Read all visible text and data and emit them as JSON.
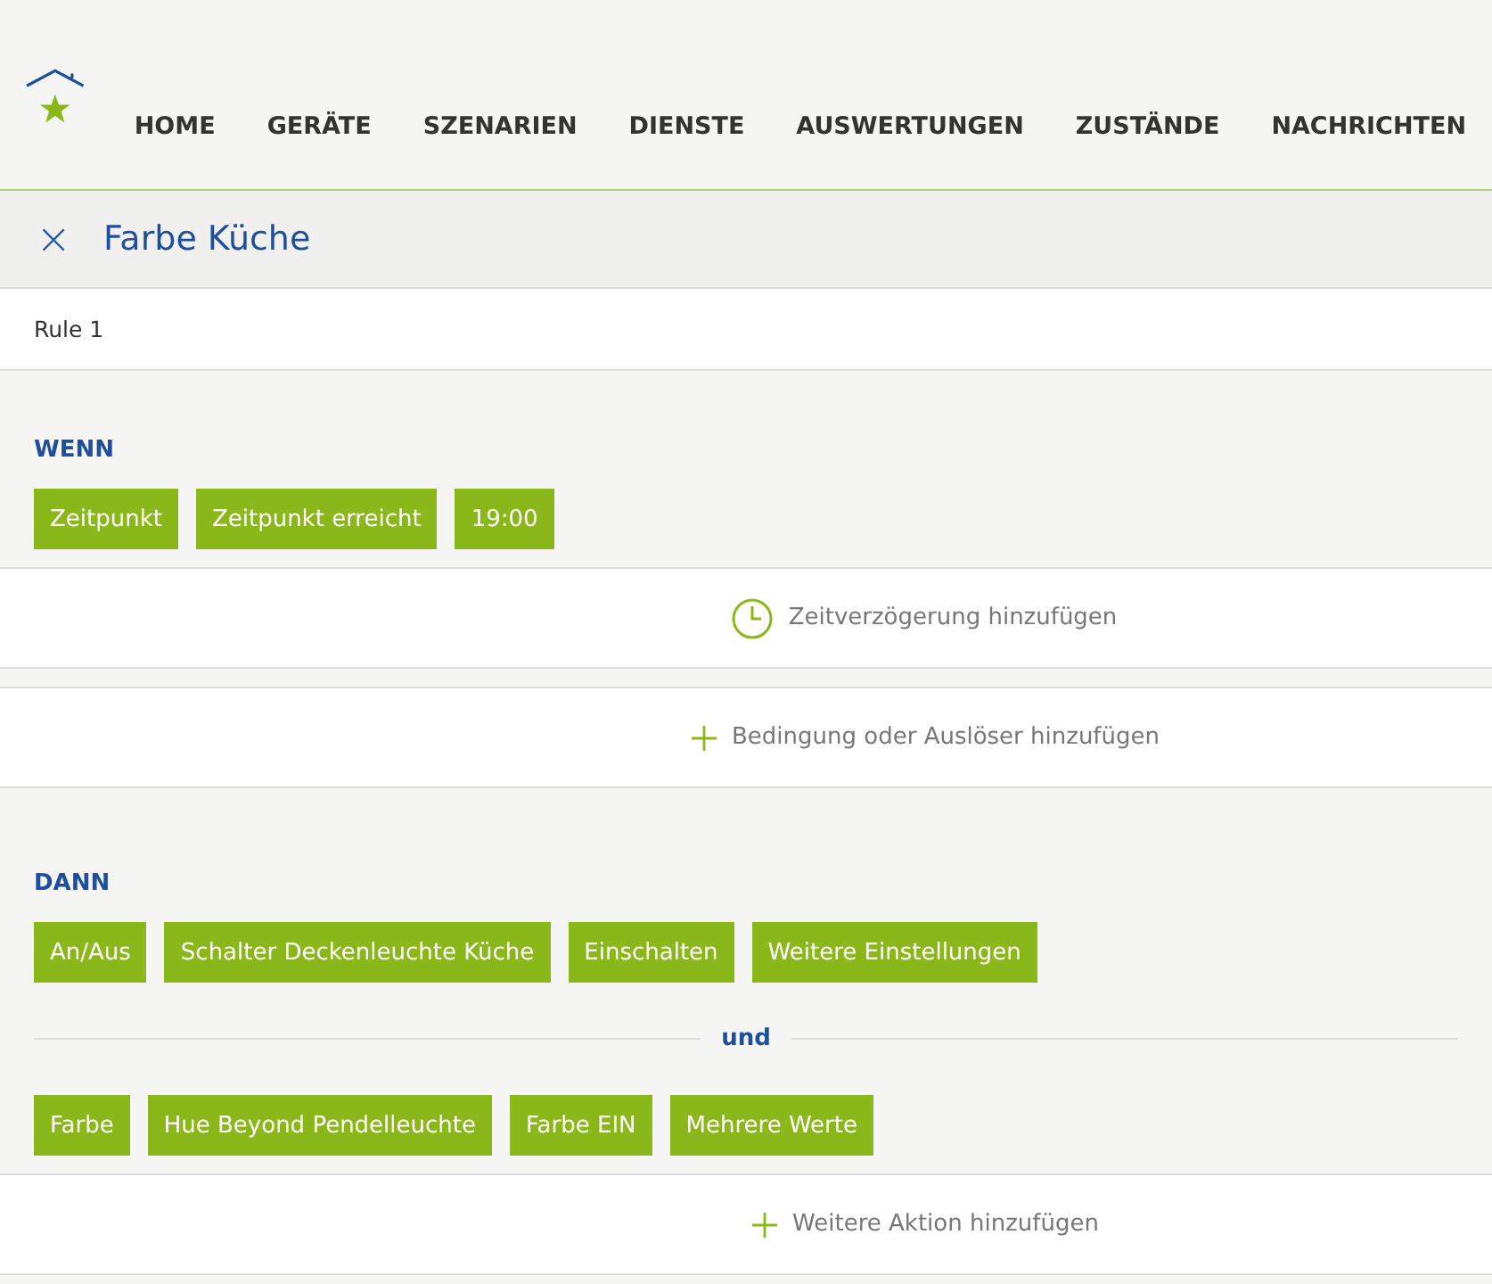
{
  "nav": {
    "items": [
      "HOME",
      "GERÄTE",
      "SZENARIEN",
      "DIENSTE",
      "AUSWERTUNGEN",
      "ZUSTÄNDE",
      "NACHRICHTEN"
    ]
  },
  "title_bar": {
    "close": "×",
    "title": "Farbe Küche"
  },
  "rule_name": "Rule 1",
  "when": {
    "heading": "WENN",
    "chips": [
      "Zeitpunkt",
      "Zeitpunkt erreicht",
      "19:00"
    ]
  },
  "when_actions": [
    {
      "kind": "clock",
      "label": "Zeitverzögerung hinzufügen"
    },
    {
      "kind": "plus",
      "label": "Bedingung oder Auslöser hinzufügen"
    }
  ],
  "then": {
    "heading": "DANN",
    "separator": "und",
    "groups": [
      [
        "An/Aus",
        "Schalter Deckenleuchte Küche",
        "Einschalten",
        "Weitere Einstellungen"
      ],
      [
        "Farbe",
        "Hue Beyond Pendelleuchte",
        "Farbe EIN",
        "Mehrere Werte"
      ]
    ]
  },
  "then_action": {
    "kind": "plus",
    "label": "Weitere Aktion hinzufügen"
  }
}
